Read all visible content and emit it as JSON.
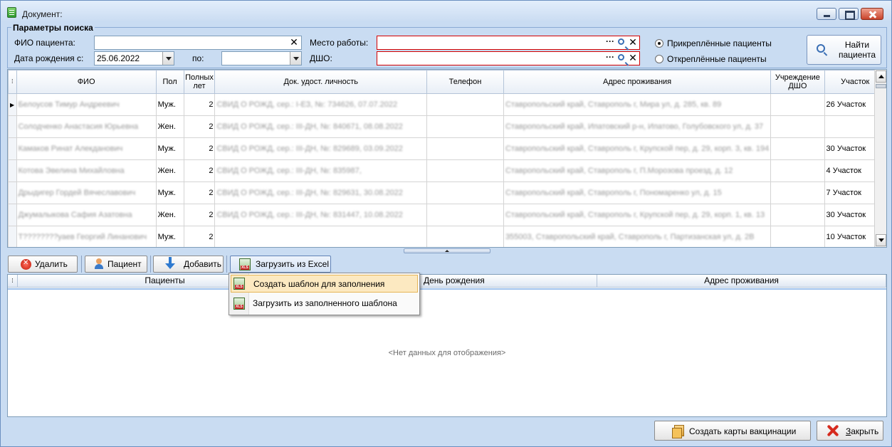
{
  "window": {
    "title": "Документ:"
  },
  "search": {
    "group_title": "Параметры поиска",
    "fio_label": "ФИО пациента:",
    "fio_value": "",
    "birth_from_label": "Дата рождения с:",
    "birth_from_value": "25.06.2022",
    "birth_to_label": "по:",
    "birth_to_value": "",
    "work_label": "Место работы:",
    "work_value": "",
    "dshо_label": "ДШО:",
    "dsho_value": "",
    "radio_attached": "Прикреплённые пациенты",
    "radio_detached": "Откреплённые пациенты",
    "radio_selected": "attached",
    "find_button_line1": "Найти",
    "find_button_line2": "пациента",
    "dots": "···"
  },
  "grid": {
    "columns": [
      "ФИО",
      "Пол",
      "Полных лет",
      "Док. удост. личность",
      "Телефон",
      "Адрес проживания",
      "Учреждение ДШО",
      "Участок"
    ],
    "rows": [
      {
        "fio": "Белоусов Тимур Андреевич",
        "sex": "Муж.",
        "age": "2",
        "doc": "СВИД О РОЖД, сер.: I-ЕЗ, №: 734626, 07.07.2022",
        "phone": "",
        "address": "Ставропольский край, Ставрополь г, Мира ул, д. 285, кв. 89",
        "dsho": "",
        "area": "26 Участок",
        "current": true
      },
      {
        "fio": "Солодченко Анастасия Юрьевна",
        "sex": "Жен.",
        "age": "2",
        "doc": "СВИД О РОЖД, сер.: ІІІ-ДН, №: 840671, 08.08.2022",
        "phone": "",
        "address": "Ставропольский край, Ипатовский р-н, Ипатово, Голубовского ул, д. 37",
        "dsho": "",
        "area": "",
        "current": false
      },
      {
        "fio": "Камаков Ринат Алекданович",
        "sex": "Муж.",
        "age": "2",
        "doc": "СВИД О РОЖД, сер.: ІІІ-ДН, №: 829689, 03.09.2022",
        "phone": "",
        "address": "Ставропольский край, Ставрополь г, Крупской пер, д. 29, корп. 3, кв. 194",
        "dsho": "",
        "area": "30 Участок",
        "current": false
      },
      {
        "fio": "Котова Эвелина Михайловна",
        "sex": "Жен.",
        "age": "2",
        "doc": "СВИД О РОЖД, сер.: ІІІ-ДН, №: 835987,",
        "phone": "",
        "address": "Ставропольский край, Ставрополь г, П.Морозова проезд, д. 12",
        "dsho": "",
        "area": "4 Участок",
        "current": false
      },
      {
        "fio": "Дрыдигер Гордей Вячеславович",
        "sex": "Муж.",
        "age": "2",
        "doc": "СВИД О РОЖД, сер.: ІІІ-ДН, №: 829631, 30.08.2022",
        "phone": "",
        "address": "Ставропольский край, Ставрополь г, Пономаренко ул, д. 15",
        "dsho": "",
        "area": "7 Участок",
        "current": false
      },
      {
        "fio": "Джумалыкова Сафия Азатовна",
        "sex": "Жен.",
        "age": "2",
        "doc": "СВИД О РОЖД, сер.: ІІІ-ДН, №: 831447, 10.08.2022",
        "phone": "",
        "address": "Ставропольский край, Ставрополь г, Крупской пер, д. 29, корп. 1, кв. 13",
        "dsho": "",
        "area": "30 Участок",
        "current": false
      },
      {
        "fio": "Т????????уаев Георгий Линанович",
        "sex": "Муж.",
        "age": "2",
        "doc": "",
        "phone": "",
        "address": "355003, Ставропольский край, Ставрополь г, Партизанская ул, д. 2В",
        "dsho": "",
        "area": "10 Участок",
        "current": false
      }
    ]
  },
  "toolbar": {
    "delete_label": "Удалить",
    "patient_label": "Пациент",
    "add_label": "Добавить",
    "excel_label": "Загрузить из Excel"
  },
  "menu": {
    "items": [
      "Создать шаблон для заполнения",
      "Загрузить из заполненного шаблона"
    ]
  },
  "grid2": {
    "columns": [
      "Пациенты",
      "День рождения",
      "Адрес проживания"
    ],
    "empty_text": "<Нет данных для отображения>"
  },
  "footer": {
    "create_cards_label": "Создать карты вакцинации",
    "close_label_underlined": "З",
    "close_label_rest": "акрыть"
  }
}
